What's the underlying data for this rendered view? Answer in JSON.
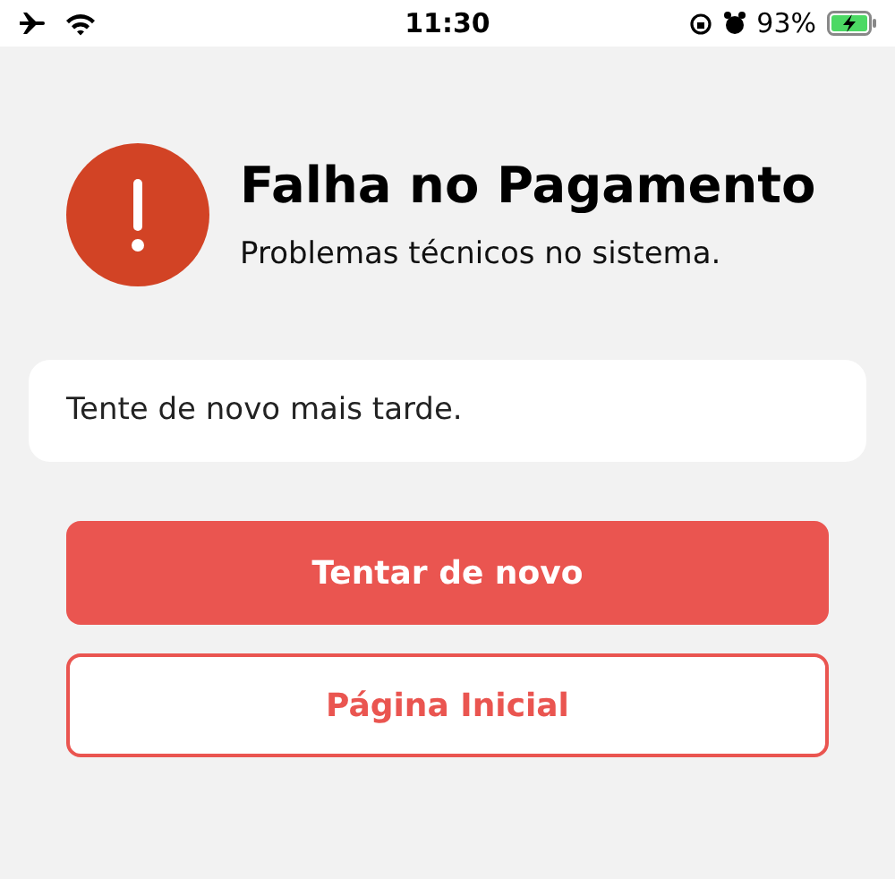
{
  "status_bar": {
    "time": "11:30",
    "battery": "93%"
  },
  "alert": {
    "title": "Falha no Pagamento",
    "subtitle": "Problemas técnicos no sistema."
  },
  "message": "Tente de novo mais tarde.",
  "buttons": [
    {
      "label": "Tentar de novo",
      "kind": "primary"
    },
    {
      "label": "Página Inicial",
      "kind": "outline"
    }
  ]
}
